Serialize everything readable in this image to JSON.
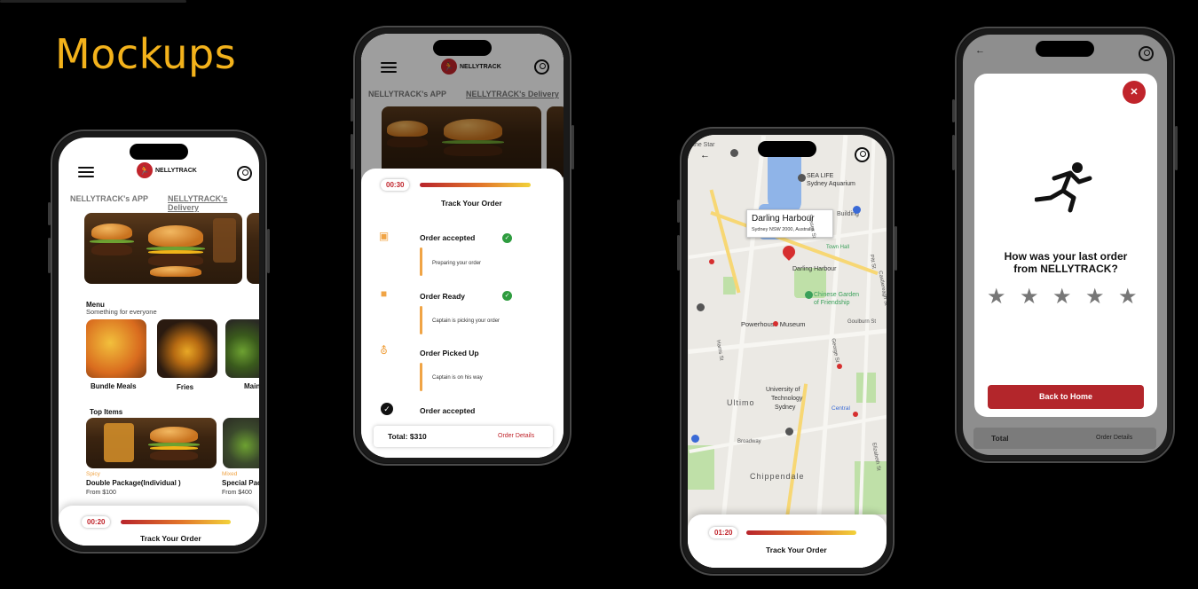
{
  "slide": {
    "title": "Mockups"
  },
  "phone1": {
    "logo_text": "NELLYTRACK",
    "tabs": [
      "NELLYTRACK's APP",
      "NELLYTRACK's Delivery"
    ],
    "menu_title": "Menu",
    "menu_subtitle": "Something for everyone",
    "menu_items": [
      "Bundle Meals",
      "Fries",
      "Mains"
    ],
    "top_items_title": "Top Items",
    "top_items": [
      {
        "tag": "Spicy",
        "name": "Double Package(Individual )",
        "price": "From $100"
      },
      {
        "tag": "Mixed",
        "name": "Special Pac",
        "price": "From $400"
      }
    ],
    "timer": "00:20",
    "track_label": "Track Your Order"
  },
  "phone2": {
    "logo_text": "NELLYTRACK",
    "tabs": [
      "NELLYTRACK's APP",
      "NELLYTRACK's Delivery"
    ],
    "timer": "00:30",
    "track_label": "Track Your Order",
    "steps": [
      {
        "title": "Order accepted",
        "detail": "Preparing your order",
        "done": true
      },
      {
        "title": "Order Ready",
        "detail": "Captain is picking your order",
        "done": true
      },
      {
        "title": "Order Picked Up",
        "detail": "Captain is on his way",
        "done": false
      },
      {
        "title": "Order accepted",
        "detail": "",
        "done": false
      }
    ],
    "total": "Total: $310",
    "order_details": "Order Details"
  },
  "phone3": {
    "place_name": "Darling Harbour",
    "place_address": "Sydney NSW 2000, Australia",
    "map_labels": [
      "SEA LIFE",
      "Sydney Aquarium",
      "Darling Harbour",
      "Chinese Garden",
      "of Friendship",
      "Powerhouse Museum",
      "University of",
      "Technology",
      "Sydney",
      "Ultimo",
      "Chippendale",
      "Town Hall",
      "Central",
      "Broadway",
      "Harris St",
      "Pitt St",
      "George St",
      "Sussex St",
      "Goulburn St",
      "Elizabeth St",
      "Castlereagh St",
      "the Star",
      "Building"
    ],
    "timer": "01:20",
    "track_label": "Track Your Order",
    "colors": {
      "pin": "#d62f2f",
      "water": "#8fb4e8",
      "park": "#bfe0a8"
    }
  },
  "phone4": {
    "question": "How was your last order from NELLYTRACK?",
    "rating": 0,
    "max_rating": 5,
    "button": "Back to Home",
    "footer_total": "Total",
    "footer_details": "Order Details"
  },
  "colors": {
    "accent": "#c0242b",
    "title": "#f3b21b",
    "step": "#f0a445",
    "check": "#2e9c3f"
  }
}
